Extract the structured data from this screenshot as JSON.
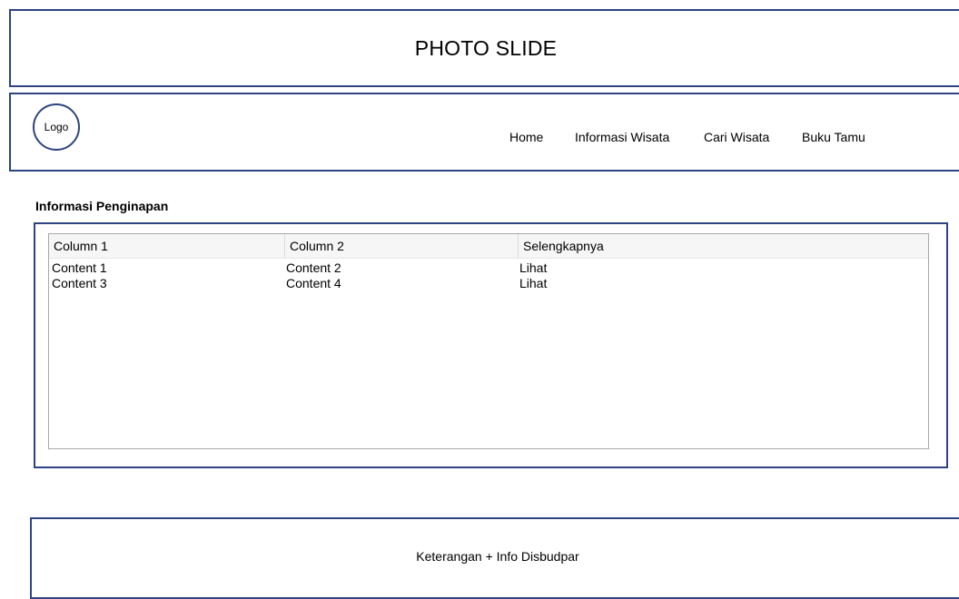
{
  "photo_slide": {
    "title": "PHOTO SLIDE"
  },
  "navbar": {
    "logo_label": "Logo",
    "links": [
      {
        "label": "Home"
      },
      {
        "label": "Informasi Wisata"
      },
      {
        "label": "Cari Wisata"
      },
      {
        "label": "Buku Tamu"
      }
    ]
  },
  "main": {
    "heading": "Informasi Penginapan",
    "table": {
      "columns": [
        "Column 1",
        "Column 2",
        "Selengkapnya"
      ],
      "rows": [
        [
          "Content 1",
          "Content 2",
          "Lihat"
        ],
        [
          "Content 3",
          "Content 4",
          "Lihat"
        ]
      ]
    }
  },
  "footer": {
    "text": "Keterangan + Info Disbudpar"
  },
  "colors": {
    "border": "#2e4482",
    "table_border": "#a9a9a9",
    "header_bg": "#f6f6f6"
  }
}
